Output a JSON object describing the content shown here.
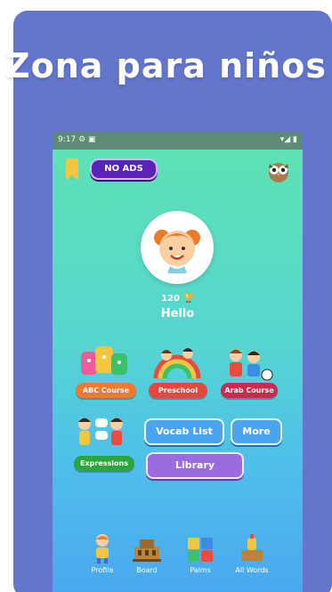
{
  "headline": "Zona para niños",
  "status_bar": {
    "left": "9:17 ⚙ ▣",
    "right": "▾◢ ▮"
  },
  "top_bar": {
    "no_ads_label": "NO ADS"
  },
  "profile": {
    "score": "120",
    "greeting": "Hello"
  },
  "courses": [
    {
      "label": "ABC Course",
      "color": "#f07b2e"
    },
    {
      "label": "Preschool",
      "color": "#e4473b"
    },
    {
      "label": "Arab Course",
      "color": "#c92a50"
    }
  ],
  "expressions": {
    "label": "Expressions",
    "color": "#2aa63c"
  },
  "buttons": {
    "vocab_list": "Vocab List",
    "more": "More",
    "library": "Library"
  },
  "bottom_nav": [
    {
      "label": "Profile",
      "icon": "kid-icon"
    },
    {
      "label": "Board",
      "icon": "building-icon"
    },
    {
      "label": "Palms",
      "icon": "puzzle-icon"
    },
    {
      "label": "All Words",
      "icon": "trophy-icon"
    }
  ]
}
